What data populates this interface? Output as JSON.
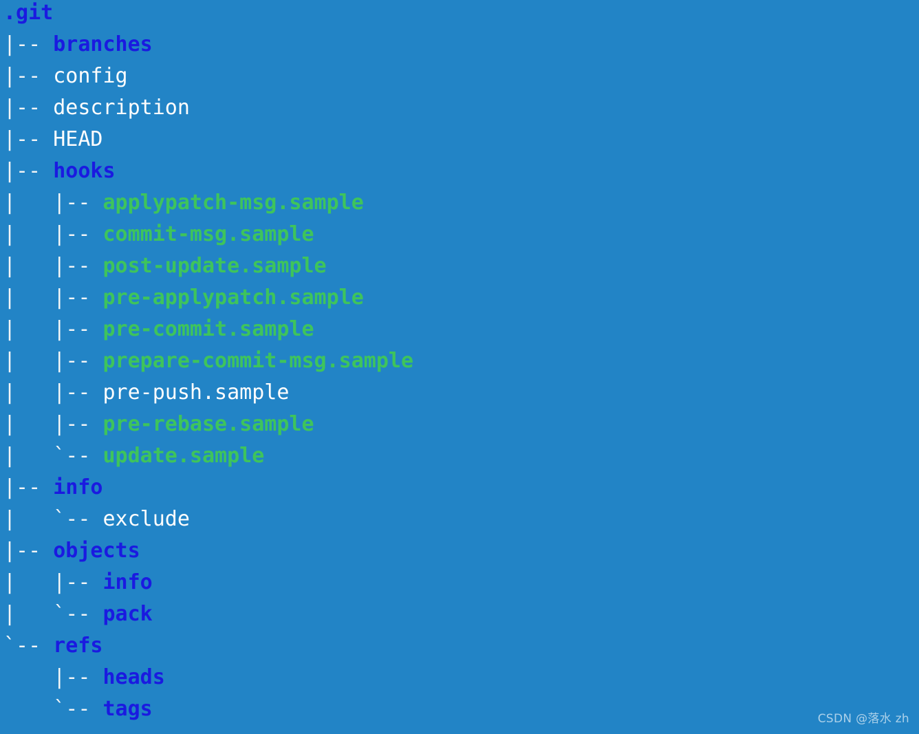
{
  "terminal": {
    "background_color": "#2284c6",
    "dir_color": "#1a1ae0",
    "exec_color": "#3ec45c",
    "file_color": "#fdfdfd",
    "prefix_color": "#f2f5f7",
    "root_label": ".git"
  },
  "watermark": {
    "text": "CSDN @落水 zh"
  },
  "tree": {
    "lines": [
      {
        "prefix": "",
        "name": ".git",
        "kind": "dir"
      },
      {
        "prefix": "|-- ",
        "name": "branches",
        "kind": "dir"
      },
      {
        "prefix": "|-- ",
        "name": "config",
        "kind": "file"
      },
      {
        "prefix": "|-- ",
        "name": "description",
        "kind": "file"
      },
      {
        "prefix": "|-- ",
        "name": "HEAD",
        "kind": "file"
      },
      {
        "prefix": "|-- ",
        "name": "hooks",
        "kind": "dir"
      },
      {
        "prefix": "|   |-- ",
        "name": "applypatch-msg.sample",
        "kind": "exec"
      },
      {
        "prefix": "|   |-- ",
        "name": "commit-msg.sample",
        "kind": "exec"
      },
      {
        "prefix": "|   |-- ",
        "name": "post-update.sample",
        "kind": "exec"
      },
      {
        "prefix": "|   |-- ",
        "name": "pre-applypatch.sample",
        "kind": "exec"
      },
      {
        "prefix": "|   |-- ",
        "name": "pre-commit.sample",
        "kind": "exec"
      },
      {
        "prefix": "|   |-- ",
        "name": "prepare-commit-msg.sample",
        "kind": "exec"
      },
      {
        "prefix": "|   |-- ",
        "name": "pre-push.sample",
        "kind": "file"
      },
      {
        "prefix": "|   |-- ",
        "name": "pre-rebase.sample",
        "kind": "exec"
      },
      {
        "prefix": "|   `-- ",
        "name": "update.sample",
        "kind": "exec"
      },
      {
        "prefix": "|-- ",
        "name": "info",
        "kind": "dir"
      },
      {
        "prefix": "|   `-- ",
        "name": "exclude",
        "kind": "file"
      },
      {
        "prefix": "|-- ",
        "name": "objects",
        "kind": "dir"
      },
      {
        "prefix": "|   |-- ",
        "name": "info",
        "kind": "dir"
      },
      {
        "prefix": "|   `-- ",
        "name": "pack",
        "kind": "dir"
      },
      {
        "prefix": "`-- ",
        "name": "refs",
        "kind": "dir"
      },
      {
        "prefix": "    |-- ",
        "name": "heads",
        "kind": "dir"
      },
      {
        "prefix": "    `-- ",
        "name": "tags",
        "kind": "dir"
      }
    ]
  }
}
